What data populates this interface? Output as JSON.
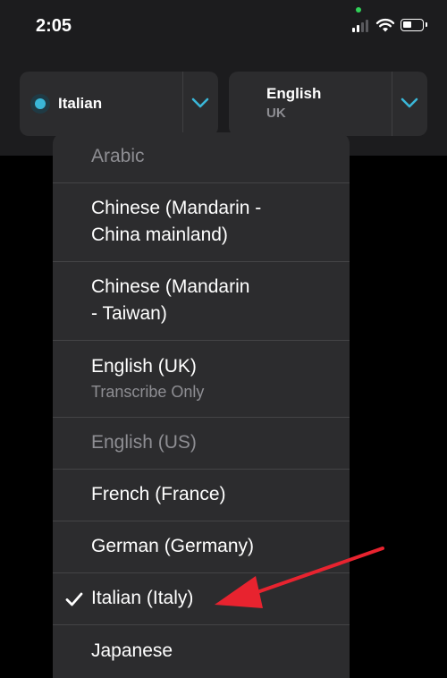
{
  "status_bar": {
    "time": "2:05"
  },
  "source_language": {
    "label": "Italian"
  },
  "target_language": {
    "label": "English",
    "sublabel": "UK"
  },
  "menu": {
    "items": [
      {
        "label": "Arabic",
        "dimmed": true
      },
      {
        "label": "Chinese (Mandarin - China mainland)",
        "line1": "Chinese (Mandarin -",
        "line2": "China mainland)"
      },
      {
        "label": "Chinese (Mandarin - Taiwan)",
        "line1": "Chinese (Mandarin",
        "line2": "- Taiwan)"
      },
      {
        "label": "English (UK)",
        "sublabel": "Transcribe Only"
      },
      {
        "label": "English (US)",
        "dimmed": true
      },
      {
        "label": "French (France)"
      },
      {
        "label": "German (Germany)"
      },
      {
        "label": "Italian (Italy)",
        "selected": true
      },
      {
        "label": "Japanese"
      }
    ]
  },
  "colors": {
    "accent": "#3ab7d8",
    "arrow": "#e8232f"
  },
  "icons": [
    "signal-icon",
    "wifi-icon",
    "battery-icon",
    "chevron-down-icon",
    "checkmark-icon",
    "annotation-arrow-icon"
  ]
}
